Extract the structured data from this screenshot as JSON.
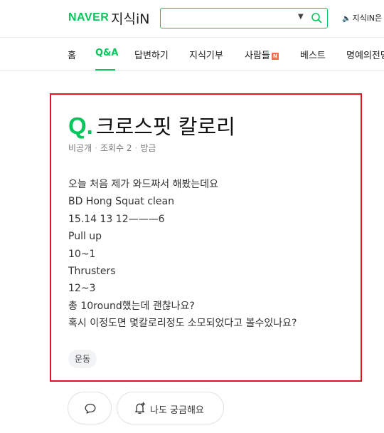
{
  "header": {
    "logo_naver": "NAVER",
    "logo_service": "지식iN",
    "search": {
      "value": "",
      "placeholder": ""
    },
    "notice": "지식iN은"
  },
  "nav": {
    "items": [
      {
        "label": "홈",
        "active": false
      },
      {
        "label": "Q&A",
        "active": true
      },
      {
        "label": "답변하기",
        "active": false
      },
      {
        "label": "지식기부",
        "active": false
      },
      {
        "label": "사람들",
        "active": false,
        "badge": "N"
      },
      {
        "label": "베스트",
        "active": false
      },
      {
        "label": "명예의전당",
        "active": false
      }
    ]
  },
  "question": {
    "q_mark": "Q.",
    "title": "크로스핏 칼로리",
    "meta": {
      "visibility": "비공개",
      "views": "조회수 2",
      "time": "방금"
    },
    "body_lines": [
      "오늘 처음 제가 와드짜서 해봤는데요",
      "BD Hong Squat clean",
      "15.14 13 12———6",
      "Pull up",
      "10~1",
      "Thrusters",
      "12~3",
      "총 10round했는데 괜찮나요?",
      "혹시 이정도면 몇칼로리정도 소모되었다고 볼수있나요?"
    ],
    "tag": "운동"
  },
  "actions": {
    "curious_label": "나도 궁금해요"
  },
  "colors": {
    "brand": "#03c75a",
    "highlight": "#e0161b"
  }
}
